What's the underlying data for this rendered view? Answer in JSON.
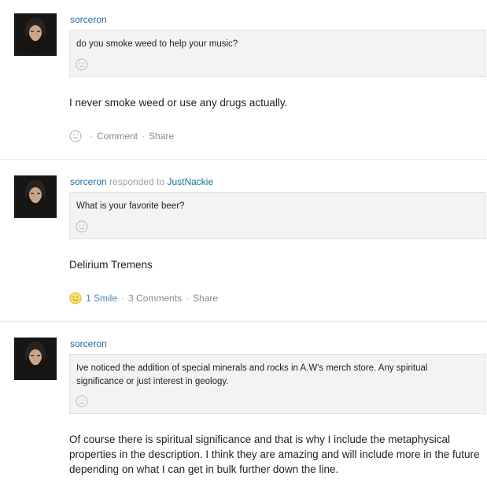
{
  "posts": [
    {
      "username": "sorceron",
      "responded": null,
      "question": "do you smoke weed to help your music?",
      "answer": "I never smoke weed or use any drugs actually.",
      "smiles": "",
      "comment": "Comment",
      "share": "Share",
      "smiled": false
    },
    {
      "username": "sorceron",
      "responded": {
        "text": "responded to",
        "target": "JustNackie"
      },
      "question": "What is your favorite beer?",
      "answer": "Delirium Tremens",
      "smiles": "1 Smile",
      "comment": "3 Comments",
      "share": "Share",
      "smiled": true
    },
    {
      "username": "sorceron",
      "responded": null,
      "question": "Ive noticed the addition of special minerals and rocks in A.W's merch store. Any spiritual significance or just interest in geology.",
      "answer": "Of course there is spiritual significance and that is why I include the metaphysical properties in the description. I think they are amazing and will include more in the future depending on what I can get in bulk further down the line.",
      "smile_icon": "smile-icon"
    }
  ],
  "colors": {
    "link": "#1b6fa5",
    "muted": "#9aa3aa",
    "action": "#7f8c99",
    "smile_active": "#f2c31a",
    "question_bg": "#f3f3f3"
  }
}
